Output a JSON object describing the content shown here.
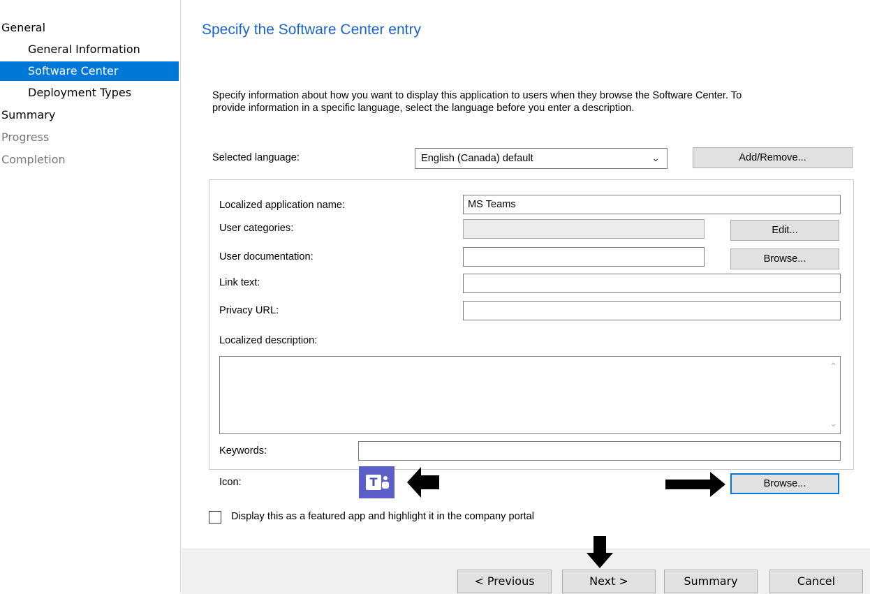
{
  "sidebar": {
    "items": [
      {
        "label": "General"
      },
      {
        "label": "General Information"
      },
      {
        "label": "Software Center"
      },
      {
        "label": "Deployment Types"
      },
      {
        "label": "Summary"
      },
      {
        "label": "Progress"
      },
      {
        "label": "Completion"
      }
    ],
    "active_color": "#0078d7"
  },
  "page": {
    "title": "Specify the Software Center entry",
    "intro_line1": "Specify information about how you want to display this application to users when they browse the Software Center. To",
    "intro_line2": "provide information in a specific language, select the language before you enter a description."
  },
  "language": {
    "label": "Selected language:",
    "value": "English (Canada) default",
    "add_remove_label": "Add/Remove..."
  },
  "form": {
    "app_name_label": "Localized application name:",
    "app_name_value": "MS Teams",
    "user_categories_label": "User categories:",
    "user_categories_value": "",
    "edit_label": "Edit...",
    "user_doc_label": "User documentation:",
    "user_doc_value": "",
    "browse_doc_label": "Browse...",
    "link_text_label": "Link text:",
    "link_text_value": "",
    "privacy_url_label": "Privacy URL:",
    "privacy_url_value": "",
    "description_label": "Localized description:",
    "description_value": "",
    "keywords_label": "Keywords:",
    "keywords_value": "",
    "icon_label": "Icon:",
    "icon_letter": "T",
    "icon_name": "microsoft-teams-icon",
    "icon_color": "#5b5fc7",
    "browse_icon_label": "Browse..."
  },
  "featured": {
    "label": "Display this as a featured app and highlight it in the company portal",
    "checked": false
  },
  "footer": {
    "previous_label": "< Previous",
    "next_label": "Next >",
    "summary_label": "Summary",
    "cancel_label": "Cancel"
  },
  "annotations": {
    "arrow_color": "#000000"
  }
}
